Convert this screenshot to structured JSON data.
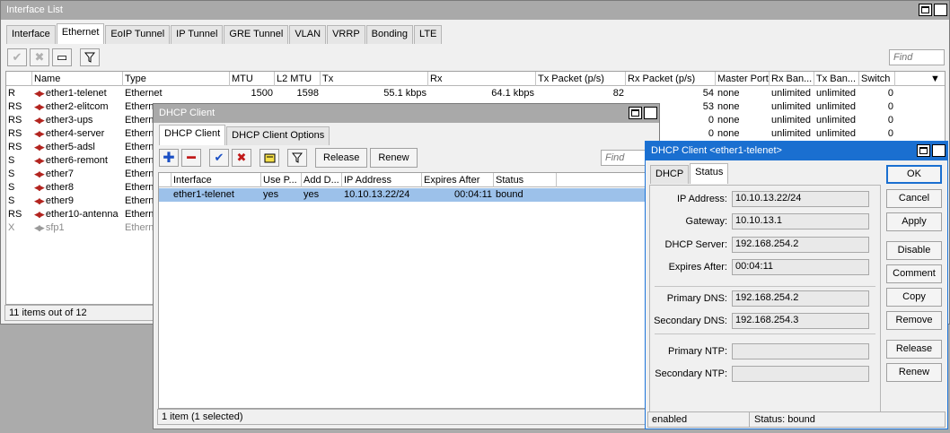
{
  "interface_list": {
    "title": "Interface List",
    "tabs": [
      "Interface",
      "Ethernet",
      "EoIP Tunnel",
      "IP Tunnel",
      "GRE Tunnel",
      "VLAN",
      "VRRP",
      "Bonding",
      "LTE"
    ],
    "find_placeholder": "Find",
    "columns": [
      "",
      "Name",
      "Type",
      "MTU",
      "L2 MTU",
      "Tx",
      "Rx",
      "Tx Packet (p/s)",
      "Rx Packet (p/s)",
      "Master Port",
      "Rx Ban...",
      "Tx Ban...",
      "Switch"
    ],
    "rows": [
      {
        "flag": "R",
        "name": "ether1-telenet",
        "type": "Ethernet",
        "mtu": "1500",
        "l2mtu": "1598",
        "tx": "55.1 kbps",
        "rx": "64.1 kbps",
        "txp": "82",
        "rxp": "54",
        "master": "none",
        "rxban": "unlimited",
        "txban": "unlimited",
        "switch": "0"
      },
      {
        "flag": "RS",
        "name": "ether2-elitcom",
        "type": "Etherne",
        "mtu": "",
        "l2mtu": "",
        "tx": "",
        "rx": "",
        "txp": "",
        "rxp": "53",
        "master": "none",
        "rxban": "unlimited",
        "txban": "unlimited",
        "switch": "0"
      },
      {
        "flag": "RS",
        "name": "ether3-ups",
        "type": "Etherne",
        "mtu": "",
        "l2mtu": "",
        "tx": "",
        "rx": "",
        "txp": "",
        "rxp": "0",
        "master": "none",
        "rxban": "unlimited",
        "txban": "unlimited",
        "switch": "0"
      },
      {
        "flag": "RS",
        "name": "ether4-server",
        "type": "Etherne",
        "mtu": "",
        "l2mtu": "",
        "tx": "",
        "rx": "",
        "txp": "",
        "rxp": "0",
        "master": "none",
        "rxban": "unlimited",
        "txban": "unlimited",
        "switch": "0"
      },
      {
        "flag": "RS",
        "name": "ether5-adsl",
        "type": "Etherne",
        "mtu": "",
        "l2mtu": "",
        "tx": "",
        "rx": "",
        "txp": "",
        "rxp": "",
        "master": "",
        "rxban": "",
        "txban": "",
        "switch": ""
      },
      {
        "flag": "S",
        "name": "ether6-remont",
        "type": "Etherne",
        "mtu": "",
        "l2mtu": "",
        "tx": "",
        "rx": "",
        "txp": "",
        "rxp": "",
        "master": "",
        "rxban": "",
        "txban": "",
        "switch": ""
      },
      {
        "flag": "S",
        "name": "ether7",
        "type": "Etherne",
        "mtu": "",
        "l2mtu": "",
        "tx": "",
        "rx": "",
        "txp": "",
        "rxp": "",
        "master": "",
        "rxban": "",
        "txban": "",
        "switch": ""
      },
      {
        "flag": "S",
        "name": "ether8",
        "type": "Etherne",
        "mtu": "",
        "l2mtu": "",
        "tx": "",
        "rx": "",
        "txp": "",
        "rxp": "",
        "master": "",
        "rxban": "",
        "txban": "",
        "switch": ""
      },
      {
        "flag": "S",
        "name": "ether9",
        "type": "Etherne",
        "mtu": "",
        "l2mtu": "",
        "tx": "",
        "rx": "",
        "txp": "",
        "rxp": "",
        "master": "",
        "rxban": "",
        "txban": "",
        "switch": ""
      },
      {
        "flag": "RS",
        "name": "ether10-antenna",
        "type": "Etherne",
        "mtu": "",
        "l2mtu": "",
        "tx": "",
        "rx": "",
        "txp": "",
        "rxp": "",
        "master": "",
        "rxban": "",
        "txban": "",
        "switch": ""
      },
      {
        "flag": "X",
        "name": "sfp1",
        "type": "Etherne",
        "mtu": "",
        "l2mtu": "",
        "tx": "",
        "rx": "",
        "txp": "",
        "rxp": "",
        "master": "",
        "rxban": "",
        "txban": "",
        "switch": "",
        "disabled": true
      }
    ],
    "status": "11 items out of 12"
  },
  "dhcp_client": {
    "title": "DHCP Client",
    "tabs": [
      "DHCP Client",
      "DHCP Client Options"
    ],
    "release_label": "Release",
    "renew_label": "Renew",
    "find_placeholder": "Find",
    "columns": [
      "",
      "Interface",
      "Use P...",
      "Add D...",
      "IP Address",
      "Expires After",
      "Status"
    ],
    "rows": [
      {
        "interface": "ether1-telenet",
        "use_peer": "yes",
        "add_default": "yes",
        "ip": "10.10.13.22/24",
        "expires": "00:04:11",
        "status": "bound"
      }
    ],
    "status": "1 item (1 selected)"
  },
  "detail": {
    "title": "DHCP Client <ether1-telenet>",
    "tabs": [
      "DHCP",
      "Status"
    ],
    "fields": [
      {
        "label": "IP Address:",
        "value": "10.10.13.22/24"
      },
      {
        "label": "Gateway:",
        "value": "10.10.13.1"
      },
      {
        "label": "DHCP Server:",
        "value": "192.168.254.2"
      },
      {
        "label": "Expires After:",
        "value": "00:04:11"
      },
      {
        "label": "Primary DNS:",
        "value": "192.168.254.2"
      },
      {
        "label": "Secondary DNS:",
        "value": "192.168.254.3"
      },
      {
        "label": "Primary NTP:",
        "value": ""
      },
      {
        "label": "Secondary NTP:",
        "value": ""
      }
    ],
    "buttons": [
      "OK",
      "Cancel",
      "Apply",
      "Disable",
      "Comment",
      "Copy",
      "Remove",
      "Release",
      "Renew"
    ],
    "status_left": "enabled",
    "status_right": "Status: bound"
  }
}
